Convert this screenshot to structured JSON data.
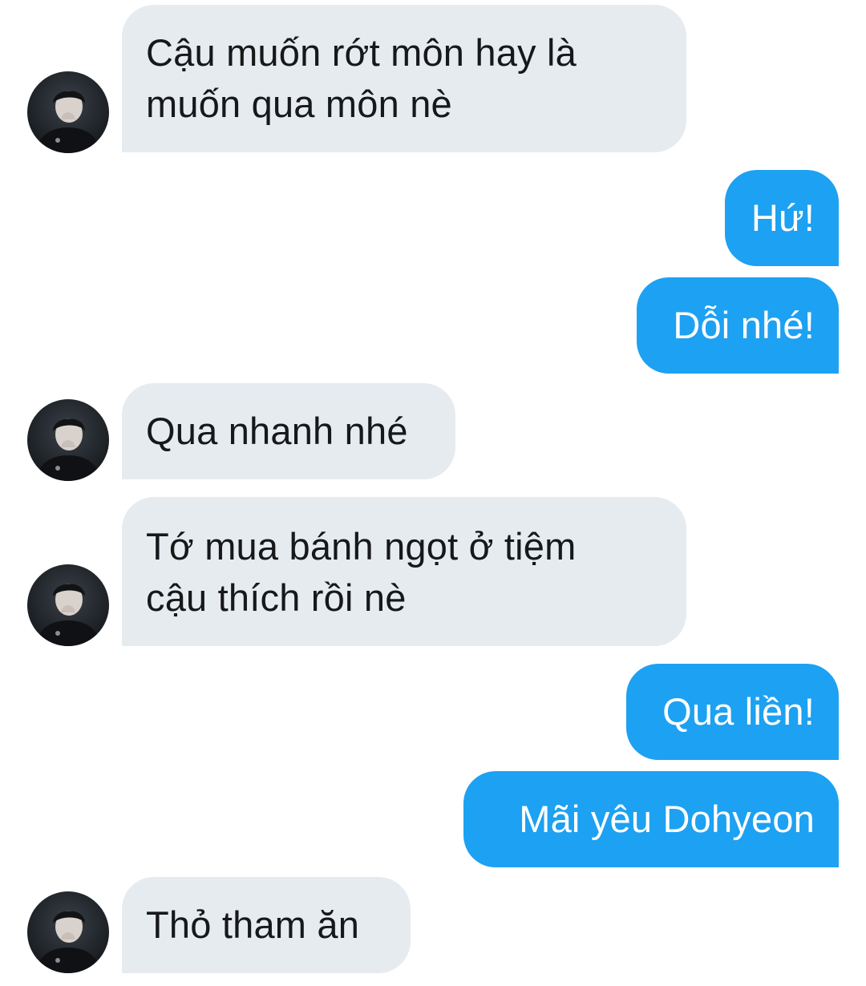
{
  "conversation": {
    "messages": [
      {
        "sender": "contact",
        "text": "Cậu muốn rớt môn hay là\nmuốn qua môn nè"
      },
      {
        "sender": "me",
        "text": "Hứ!"
      },
      {
        "sender": "me",
        "text": "Dỗi nhé!"
      },
      {
        "sender": "contact",
        "text": "Qua nhanh nhé"
      },
      {
        "sender": "contact",
        "text": "Tớ mua bánh ngọt ở tiệm\ncậu thích rồi nè"
      },
      {
        "sender": "me",
        "text": "Qua liền!"
      },
      {
        "sender": "me",
        "text": "Mãi yêu Dohyeon"
      },
      {
        "sender": "contact",
        "text": "Thỏ tham ăn"
      }
    ]
  },
  "colors": {
    "incoming_bubble": "#e6ebf0",
    "outgoing_bubble": "#1da1f2",
    "incoming_text": "#16181a",
    "outgoing_text": "#ffffff"
  },
  "icons": {
    "contact_avatar": "avatar-icon"
  }
}
